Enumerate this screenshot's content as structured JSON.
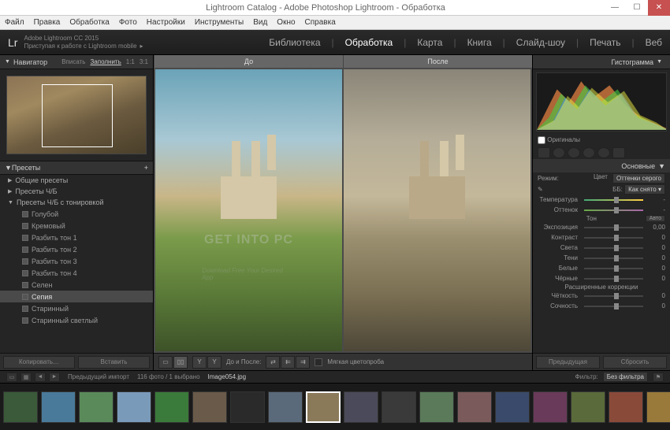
{
  "window": {
    "title": "Lightroom Catalog - Adobe Photoshop Lightroom - Обработка"
  },
  "menubar": [
    "Файл",
    "Правка",
    "Обработка",
    "Фото",
    "Настройки",
    "Инструменты",
    "Вид",
    "Окно",
    "Справка"
  ],
  "header": {
    "logo": "Lr",
    "brand": "Adobe Lightroom CC 2015",
    "sub": "Приступая к работе с Lightroom mobile",
    "modules": [
      "Библиотека",
      "Обработка",
      "Карта",
      "Книга",
      "Слайд-шоу",
      "Печать",
      "Веб"
    ],
    "active_module": 1
  },
  "navigator": {
    "title": "Навигатор",
    "opts": [
      "Вписать",
      "Заполнить",
      "1:1",
      "3:1"
    ]
  },
  "presets": {
    "title": "Пресеты",
    "groups": [
      {
        "label": "Общие пресеты",
        "open": false
      },
      {
        "label": "Пресеты Ч/Б",
        "open": false
      },
      {
        "label": "Пресеты Ч/Б с тонировкой",
        "open": true,
        "items": [
          "Голубой",
          "Кремовый",
          "Разбить тон 1",
          "Разбить тон 2",
          "Разбить тон 3",
          "Разбить тон 4",
          "Селен",
          "Сепия",
          "Старинный",
          "Старинный светлый"
        ],
        "selected": 7
      }
    ],
    "copy_btn": "Копировать…",
    "paste_btn": "Вставить"
  },
  "compare": {
    "before": "До",
    "after": "После"
  },
  "watermark": {
    "main": "GET INTO PC",
    "sub": "Download Free Your Desired App"
  },
  "canvas_toolbar": {
    "label": "До и После:",
    "softproof": "Мягкая цветопроба"
  },
  "right": {
    "histogram": "Гистограмма",
    "originals": "Оригиналы",
    "basic_title": "Основные",
    "mode": "Режим:",
    "color": "Цвет",
    "grayscale": "Оттенки серого",
    "wb_label": "ББ:",
    "wb_value": "Как снято",
    "temp": "Температура",
    "tint": "Оттенок",
    "tone": "Тон",
    "auto": "Авто",
    "exposure": "Экспозиция",
    "exposure_val": "0,00",
    "contrast": "Контраст",
    "zero": "0",
    "highlights": "Света",
    "shadows": "Тени",
    "whites": "Белые",
    "blacks": "Чёрные",
    "presence": "Расширенные коррекции",
    "clarity": "Чёткость",
    "vibrance": "Сочность",
    "prev_btn": "Предыдущая",
    "reset_btn": "Сбросить"
  },
  "filmstrip": {
    "prev_import": "Предыдущий импорт",
    "count": "116 фото / 1 выбрано",
    "filename": "Image054.jpg",
    "filter": "Фильтр:",
    "nofilter": "Без фильтра",
    "thumbs": [
      "#3a5a3a",
      "#4a7a9a",
      "#5a8a5a",
      "#7a9aba",
      "#3a7a3a",
      "#6a5a4a",
      "#2a2a2a",
      "#5a6a7a",
      "#8a7a5a",
      "#4a4a5a",
      "#3a3a3a",
      "#5a7a5a",
      "#7a5a5a",
      "#3a4a6a",
      "#6a3a5a",
      "#5a6a3a",
      "#8a4a3a",
      "#9a7a3a"
    ],
    "selected": 8
  }
}
